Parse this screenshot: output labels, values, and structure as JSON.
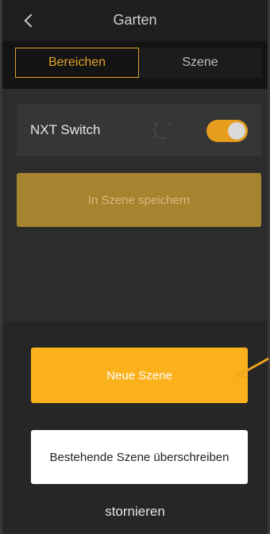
{
  "header": {
    "title": "Garten",
    "back_icon": "chevron-left-icon"
  },
  "tabs": [
    {
      "label": "Bereichen",
      "active": true
    },
    {
      "label": "Szene",
      "active": false
    }
  ],
  "device": {
    "name": "NXT Switch",
    "icon": "bulb-off-icon",
    "toggle_on": true
  },
  "save_button": {
    "label": "In Szene speichern"
  },
  "action_sheet": {
    "new_scene_label": "Neue Szene",
    "overwrite_label": "Bestehende Szene überschreiben",
    "cancel_label": "stornieren"
  },
  "colors": {
    "accent": "#fbb11b",
    "accent_dim": "#a6832e",
    "tab_border": "#e0a12a",
    "background": "#141414",
    "sheet": "#262626"
  }
}
